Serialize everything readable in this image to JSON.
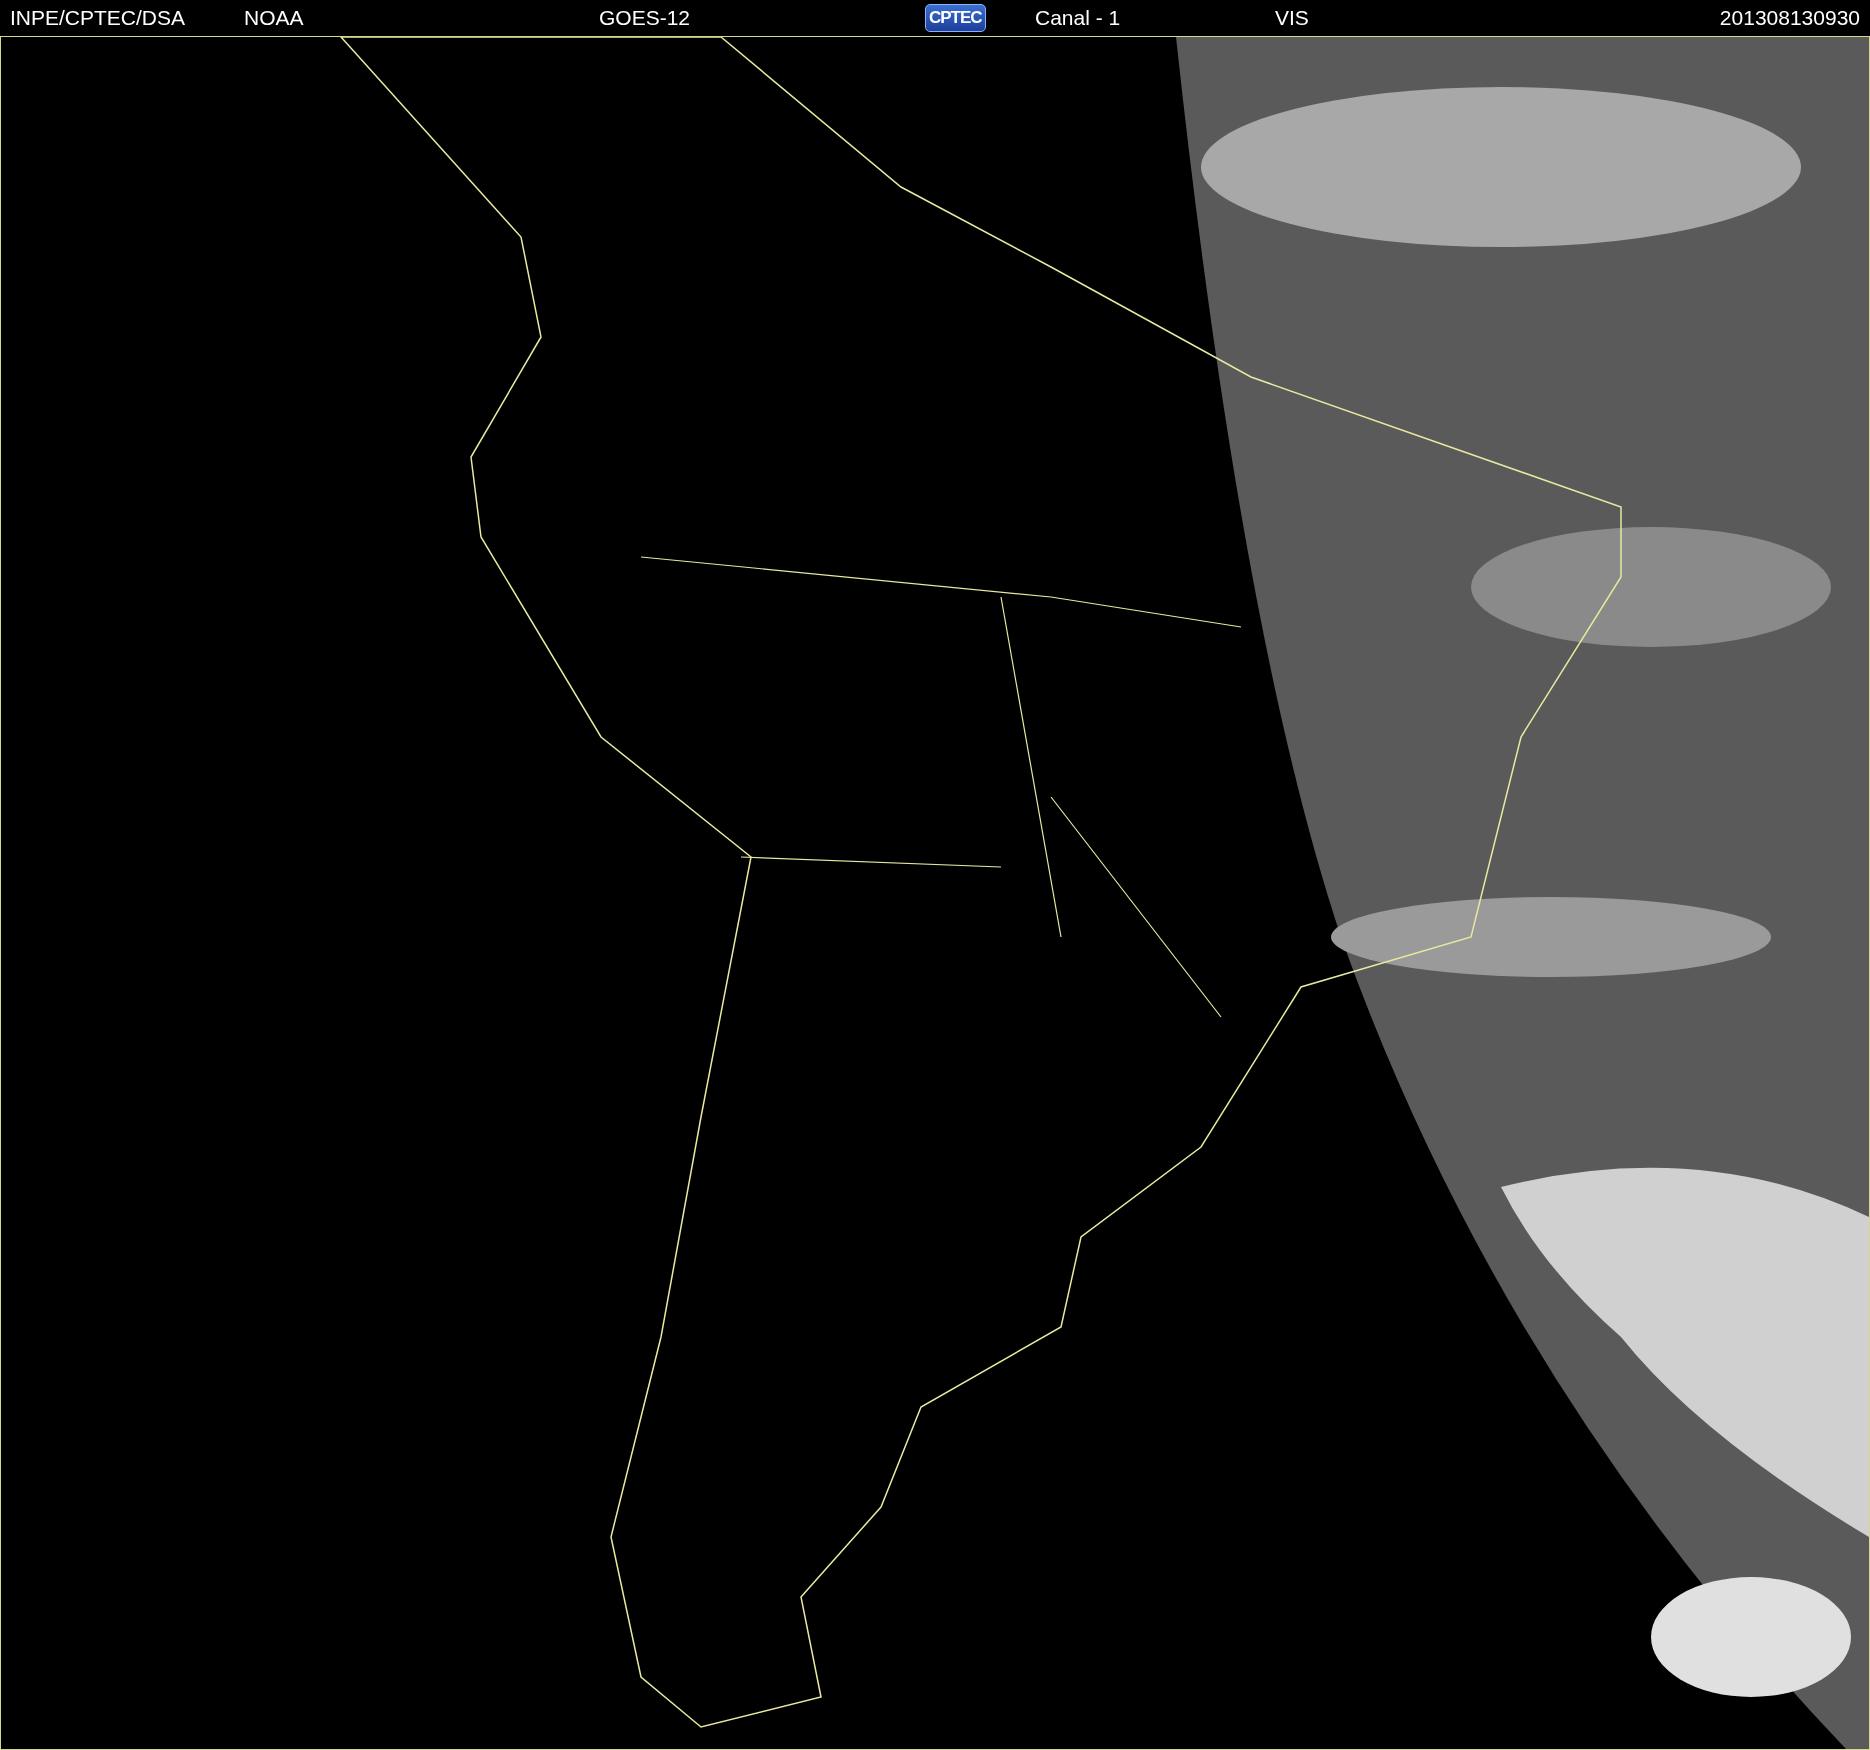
{
  "header": {
    "items": [
      {
        "kind": "text",
        "label": "INPE/CPTEC/DSA"
      },
      {
        "kind": "text",
        "label": "NOAA"
      },
      {
        "kind": "text",
        "label": "GOES-12"
      },
      {
        "kind": "logo",
        "label": "CPTEC"
      },
      {
        "kind": "text",
        "label": "Canal - 1"
      },
      {
        "kind": "text",
        "label": "VIS"
      },
      {
        "kind": "text",
        "label": "201308130930"
      }
    ]
  }
}
